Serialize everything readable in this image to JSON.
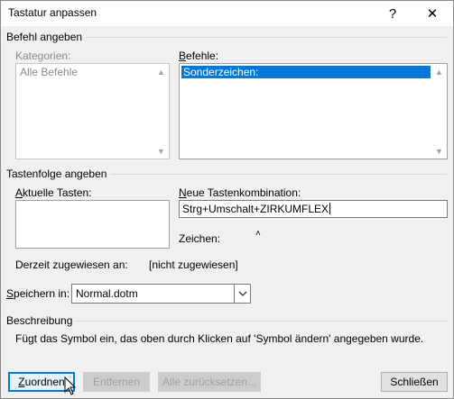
{
  "window": {
    "title": "Tastatur anpassen",
    "help_glyph": "?",
    "close_glyph": "✕"
  },
  "command_group": {
    "label": "Befehl angeben",
    "categories_label": "Kategorien:",
    "categories": [
      "Alle Befehle"
    ],
    "commands_label": "Befehle:",
    "commands": [
      "Sonderzeichen:"
    ]
  },
  "keys_group": {
    "label": "Tastenfolge angeben",
    "current_keys_label": "Aktuelle Tasten:",
    "new_combo_label": "Neue Tastenkombination:",
    "new_combo_value": "Strg+Umschalt+ZIRKUMFLEX",
    "character_label": "Zeichen:",
    "character_value": "˄",
    "assigned_label": "Derzeit zugewiesen an:",
    "assigned_value": "[nicht zugewiesen]"
  },
  "save_in": {
    "label": "Speichern in:",
    "value": "Normal.dotm"
  },
  "description": {
    "label": "Beschreibung",
    "text": "Fügt das Symbol ein, das oben durch Klicken auf 'Symbol ändern' angegeben wurde."
  },
  "buttons": {
    "assign": "Zuordnen",
    "remove": "Entfernen",
    "reset_all": "Alle zurücksetzen...",
    "close": "Schließen"
  },
  "colors": {
    "selection": "#0078d7",
    "dialog_bg": "#f0f0f0",
    "disabled_text": "#8a8a8a"
  }
}
